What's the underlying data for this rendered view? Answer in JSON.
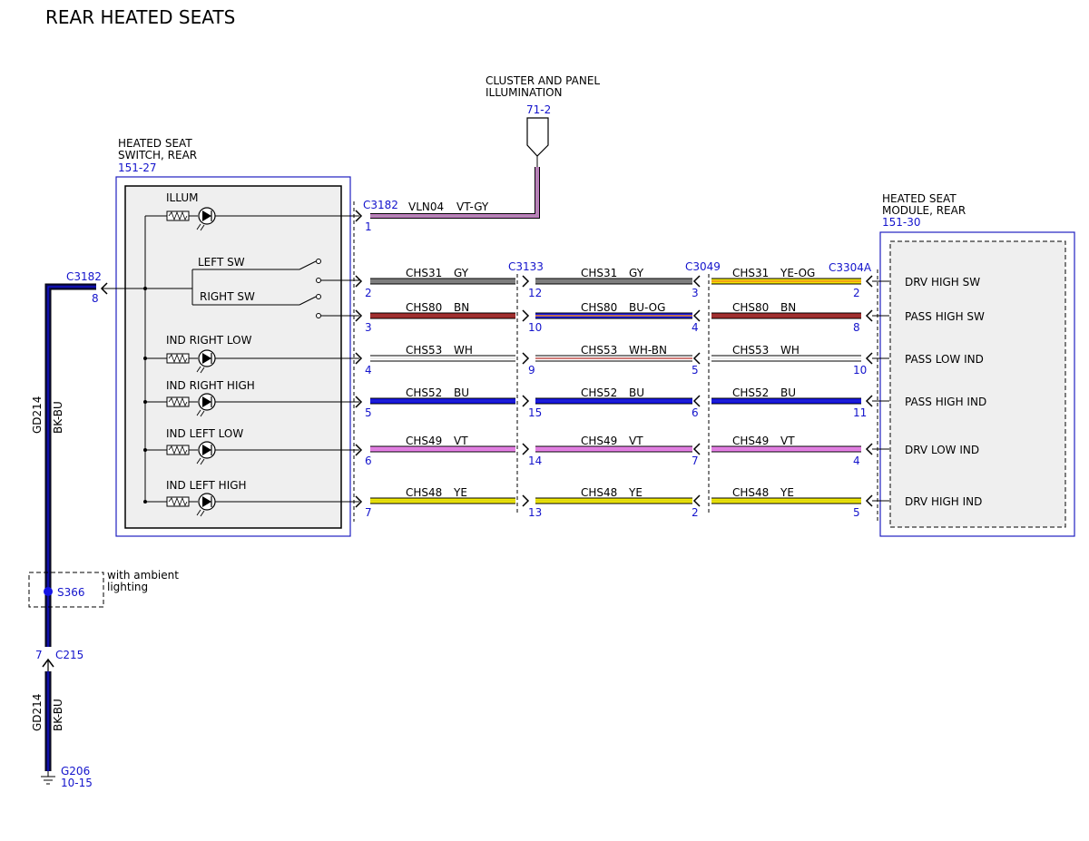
{
  "title": "REAR HEATED SEATS",
  "cluster": {
    "label_line1": "CLUSTER AND PANEL",
    "label_line2": "ILLUMINATION",
    "ref": "71-2"
  },
  "switch": {
    "name_line1": "HEATED SEAT",
    "name_line2": "SWITCH, REAR",
    "ref": "151-27",
    "ground_connector": "C3182",
    "ground_pin": "8",
    "illum_connector": "C3182",
    "illum_pin": "1",
    "illum_circuit": "VLN04",
    "illum_color": "VT-GY",
    "labels": {
      "illum": "ILLUM",
      "left_sw": "LEFT SW",
      "right_sw": "RIGHT SW",
      "ind_right_low": "IND RIGHT LOW",
      "ind_right_high": "IND RIGHT HIGH",
      "ind_left_low": "IND LEFT LOW",
      "ind_left_high": "IND LEFT HIGH"
    }
  },
  "module": {
    "name_line1": "HEATED SEAT",
    "name_line2": "MODULE, REAR",
    "ref": "151-30",
    "connector": "C3304A"
  },
  "inline_connectors": {
    "c1": "C3133",
    "c2": "C3049"
  },
  "wires": [
    {
      "seg1_circuit": "CHS31",
      "seg1_color": "GY",
      "seg2_circuit": "CHS31",
      "seg2_color": "GY",
      "seg3_circuit": "CHS31",
      "seg3_color": "YE-OG",
      "pin_switch": "2",
      "pin_c3133": "12",
      "pin_c3049": "3",
      "pin_module": "2",
      "module_label": "DRV HIGH SW",
      "c1_hex": "#808080",
      "c2_hex": "#808080",
      "c3_hex": "#f2e600",
      "c3_stripe": "#f28c1e"
    },
    {
      "seg1_circuit": "CHS80",
      "seg1_color": "BN",
      "seg2_circuit": "CHS80",
      "seg2_color": "BU-OG",
      "seg3_circuit": "CHS80",
      "seg3_color": "BN",
      "pin_switch": "3",
      "pin_c3133": "10",
      "pin_c3049": "4",
      "pin_module": "8",
      "module_label": "PASS HIGH SW",
      "c1_hex": "#a52a2a",
      "c2_hex": "#1a1ae6",
      "c2_stripe": "#f28c1e",
      "c3_hex": "#a52a2a"
    },
    {
      "seg1_circuit": "CHS53",
      "seg1_color": "WH",
      "seg2_circuit": "CHS53",
      "seg2_color": "WH-BN",
      "seg3_circuit": "CHS53",
      "seg3_color": "WH",
      "pin_switch": "4",
      "pin_c3133": "9",
      "pin_c3049": "5",
      "pin_module": "10",
      "module_label": "PASS LOW IND",
      "c1_hex": "#ffffff",
      "c2_hex": "#ffffff",
      "c2_stripe": "#c0504d",
      "c3_hex": "#ffffff"
    },
    {
      "seg1_circuit": "CHS52",
      "seg1_color": "BU",
      "seg2_circuit": "CHS52",
      "seg2_color": "BU",
      "seg3_circuit": "CHS52",
      "seg3_color": "BU",
      "pin_switch": "5",
      "pin_c3133": "15",
      "pin_c3049": "6",
      "pin_module": "11",
      "module_label": "PASS HIGH IND",
      "c1_hex": "#1414e6",
      "c2_hex": "#1414e6",
      "c3_hex": "#1414e6"
    },
    {
      "seg1_circuit": "CHS49",
      "seg1_color": "VT",
      "seg2_circuit": "CHS49",
      "seg2_color": "VT",
      "seg3_circuit": "CHS49",
      "seg3_color": "VT",
      "pin_switch": "6",
      "pin_c3133": "14",
      "pin_c3049": "7",
      "pin_module": "4",
      "module_label": "DRV LOW IND",
      "c1_hex": "#ee82ee",
      "c2_hex": "#ee82ee",
      "c3_hex": "#ee82ee"
    },
    {
      "seg1_circuit": "CHS48",
      "seg1_color": "YE",
      "seg2_circuit": "CHS48",
      "seg2_color": "YE",
      "seg3_circuit": "CHS48",
      "seg3_color": "YE",
      "pin_switch": "7",
      "pin_c3133": "13",
      "pin_c3049": "2",
      "pin_module": "5",
      "module_label": "DRV HIGH IND",
      "c1_hex": "#f2ea00",
      "c2_hex": "#f2ea00",
      "c3_hex": "#f2ea00"
    }
  ],
  "ground": {
    "circuit": "GD214",
    "color": "BK-BU",
    "splice": "S366",
    "splice_note_line1": "with ambient",
    "splice_note_line2": "lighting",
    "inline_connector": "C215",
    "inline_pin": "7",
    "ground_point": "G206",
    "ground_ref": "10-15"
  },
  "colors": {
    "ref_blue": "#1414cc",
    "frame_blue": "#2020c0",
    "vt_gy": "#c678c6",
    "bk_bu": "#0a0a50"
  }
}
